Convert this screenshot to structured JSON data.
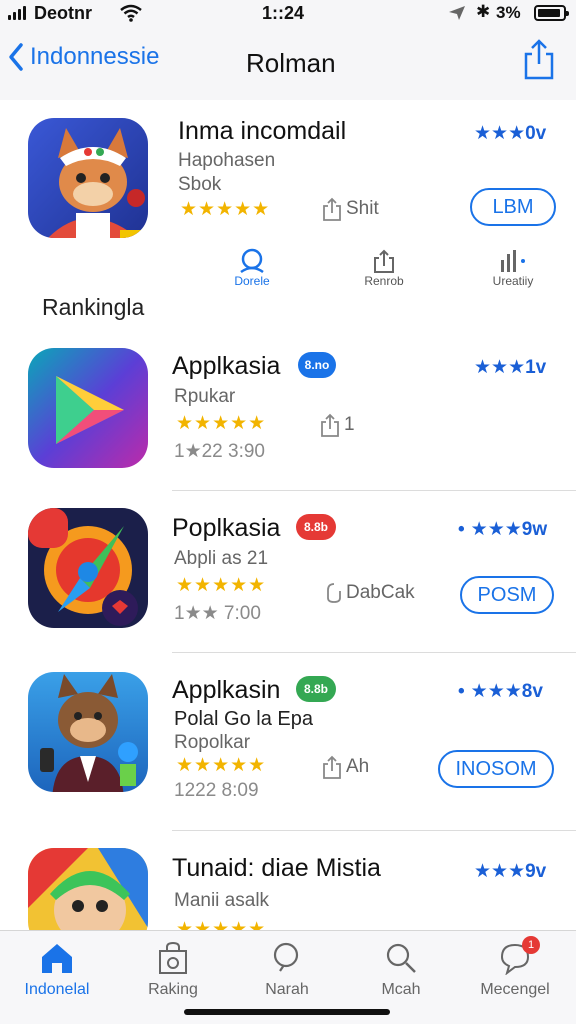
{
  "status_bar": {
    "carrier": "Deotnr",
    "time": "1::24",
    "battery": "3%"
  },
  "nav": {
    "back_label": "Indonnessie",
    "title": "Rolman"
  },
  "featured": {
    "name": "Inma incomdail",
    "sub1": "Hapohasen",
    "sub2": "Sbok",
    "stars": "★★★★★",
    "share_label": "Shit",
    "rating": "★★★0v",
    "button": "LBM"
  },
  "inline_tabs": [
    {
      "label": "Dorele"
    },
    {
      "label": "Renrob"
    },
    {
      "label": "Ureatiiy"
    }
  ],
  "section_label": "Rankingla",
  "apps": [
    {
      "name": "Applkasia",
      "badge": "8.no",
      "badge_color": "#1a73e8",
      "sub": "Rpukar",
      "stars": "★★★★★",
      "meta": "1★22 3:90",
      "share_label": "1",
      "rating": "★★★1v",
      "button": ""
    },
    {
      "name": "Poplkasia",
      "badge": "8.8b",
      "badge_color": "#e53935",
      "sub": "Abpli as 21",
      "stars": "★★★★★",
      "meta": "1★★ 7:00",
      "share_label": "DabCak",
      "rating": "★★★9w",
      "button": "POSM"
    },
    {
      "name": "Applkasin",
      "badge": "8.8b",
      "badge_color": "#34a853",
      "sub": "Polal Go la Epa",
      "sub2": "Ropolkar",
      "stars": "★★★★★",
      "meta": "1222 8:09",
      "share_label": "Ah",
      "rating": "★★★8v",
      "button": "INOSOM"
    },
    {
      "name": "Tunaid: diae Mistia",
      "sub": "Manii asalk",
      "stars": "★★★★★",
      "rating": "★★★9v"
    }
  ],
  "tabbar": [
    {
      "label": "Indonelal",
      "icon": "home-icon"
    },
    {
      "label": "Raking",
      "icon": "ranking-icon"
    },
    {
      "label": "Narah",
      "icon": "search-tab-icon"
    },
    {
      "label": "Mcah",
      "icon": "magnifier-icon"
    },
    {
      "label": "Mecengel",
      "icon": "message-icon"
    }
  ],
  "notification_count": "1",
  "colors": {
    "accent": "#1a73e8",
    "star": "#f2b400",
    "rating": "#1a5fd6"
  }
}
